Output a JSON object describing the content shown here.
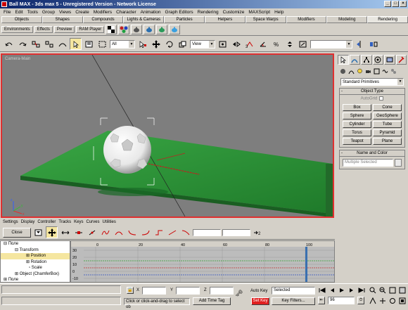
{
  "window": {
    "title": "Ball MAX - 3ds max 5 - Unregistered Version - Network License"
  },
  "menu": [
    "File",
    "Edit",
    "Tools",
    "Group",
    "Views",
    "Create",
    "Modifiers",
    "Character",
    "Animation",
    "Graph Editors",
    "Rendering",
    "Customize",
    "MAXScript",
    "Help"
  ],
  "tabs": [
    "Objects",
    "Shapes",
    "Compounds",
    "Lights & Cameras",
    "Particles",
    "Helpers",
    "Space Warps",
    "Modifiers",
    "Modeling",
    "Rendering"
  ],
  "active_tab": "Rendering",
  "subbar": {
    "environments": "Environments",
    "effects": "Effects",
    "preview": "Preview",
    "ram_player": "RAM Player"
  },
  "toolbar": {
    "selection_filter": "All",
    "coord_system": "View"
  },
  "viewport": {
    "label": "Camera-Main"
  },
  "command_panel": {
    "category": "Standard Primitives",
    "object_type": {
      "title": "Object Type",
      "autogrid": "AutoGrid"
    },
    "primitives": [
      "Box",
      "Cone",
      "Sphere",
      "GeoSphere",
      "Cylinder",
      "Tube",
      "Torus",
      "Pyramid",
      "Teapot",
      "Plane"
    ],
    "name_color": {
      "title": "Name and Color",
      "name_value": "Multiple Selected"
    }
  },
  "trackview": {
    "menu": [
      "Settings",
      "Display",
      "Controller",
      "Tracks",
      "Keys",
      "Curves",
      "Utilities"
    ],
    "close_label": "Close",
    "tree": [
      {
        "label": "Поле",
        "indent": 1,
        "selected": false
      },
      {
        "label": "Transform",
        "indent": 2,
        "selected": false
      },
      {
        "label": "Position",
        "indent": 3,
        "selected": true
      },
      {
        "label": "Rotation",
        "indent": 3,
        "selected": false
      },
      {
        "label": "Scale",
        "indent": 3,
        "selected": false
      },
      {
        "label": "Object (ChamferBox)",
        "indent": 2,
        "selected": false
      },
      {
        "label": "Поле",
        "indent": 1,
        "selected": false
      }
    ],
    "ruler_ticks": [
      "0",
      "20",
      "40",
      "60",
      "80",
      "100"
    ],
    "value_ticks": [
      "30",
      "20",
      "10",
      "0",
      "-10"
    ]
  },
  "status": {
    "prompt": "Click or click-and-drag to select ob",
    "add_time_tag": "Add Time Tag",
    "x_label": "X",
    "y_label": "Y",
    "z_label": "Z",
    "auto_key": "Auto Key",
    "set_key": "Set Key",
    "key_mode": "Selected",
    "key_filters": "Key Filters...",
    "frame": "96"
  },
  "colors": {
    "viewport_border": "#e03030",
    "plane_green": "#2e9b3a",
    "set_key_red": "#e02020"
  }
}
